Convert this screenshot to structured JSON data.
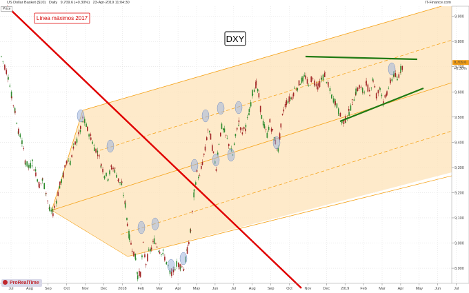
{
  "header": {
    "instrument": "US Dollar Basket ($10)",
    "interval": "Daily",
    "quote": "9,709.6 (+0.30%)",
    "timestamp": "23-Apr-2019 11:04:30",
    "source": "IT-Finance.com",
    "price_label": "Price"
  },
  "logo": {
    "text": "ProRealTime"
  },
  "chart_data": {
    "type": "candlestick",
    "title": "",
    "x_tick_labels": [
      "Jul",
      "Aug",
      "Sep",
      "Oct",
      "Nov",
      "Dec",
      "2018",
      "Feb",
      "Mar",
      "Apr",
      "May",
      "Jun",
      "Jul",
      "Aug",
      "Sep",
      "Oct",
      "Nov",
      "Dec",
      "2019",
      "Feb",
      "Mar",
      "Apr",
      "May",
      "Jun",
      "Jul"
    ],
    "y_tick_labels": [
      "9,900",
      "9,800",
      "9,700",
      "9,600",
      "9,500",
      "9,400",
      "9,300",
      "9,200",
      "9,100",
      "9,000",
      "8,900"
    ],
    "y_tick_values": [
      9900,
      9800,
      9700,
      9600,
      9500,
      9400,
      9300,
      9200,
      9100,
      9000,
      8900
    ],
    "ylim": [
      8840,
      9940
    ],
    "last_price_label": "9,709.6",
    "last_change_label": "+0.30%",
    "last_price": 9709.6,
    "price_path": [
      [
        0,
        9740
      ],
      [
        5,
        9700
      ],
      [
        10,
        9660
      ],
      [
        15,
        9580
      ],
      [
        20,
        9520
      ],
      [
        25,
        9440
      ],
      [
        30,
        9400
      ],
      [
        35,
        9320
      ],
      [
        40,
        9300
      ],
      [
        45,
        9320
      ],
      [
        50,
        9280
      ],
      [
        55,
        9230
      ],
      [
        60,
        9250
      ],
      [
        65,
        9200
      ],
      [
        70,
        9130
      ],
      [
        75,
        9120
      ],
      [
        80,
        9170
      ],
      [
        85,
        9230
      ],
      [
        90,
        9270
      ],
      [
        95,
        9330
      ],
      [
        100,
        9320
      ],
      [
        105,
        9380
      ],
      [
        110,
        9410
      ],
      [
        115,
        9450
      ],
      [
        118,
        9490
      ],
      [
        121,
        9480
      ],
      [
        125,
        9450
      ],
      [
        130,
        9420
      ],
      [
        135,
        9380
      ],
      [
        140,
        9360
      ],
      [
        145,
        9310
      ],
      [
        150,
        9270
      ],
      [
        155,
        9260
      ],
      [
        160,
        9300
      ],
      [
        165,
        9290
      ],
      [
        170,
        9250
      ],
      [
        175,
        9230
      ],
      [
        180,
        9150
      ],
      [
        183,
        9080
      ],
      [
        186,
        9020
      ],
      [
        190,
        8980
      ],
      [
        195,
        8940
      ],
      [
        198,
        8870
      ],
      [
        202,
        8880
      ],
      [
        206,
        8990
      ],
      [
        210,
        8920
      ],
      [
        214,
        8960
      ],
      [
        218,
        8980
      ],
      [
        222,
        9010
      ],
      [
        226,
        8990
      ],
      [
        230,
        8970
      ],
      [
        235,
        8960
      ],
      [
        240,
        8920
      ],
      [
        245,
        8880
      ],
      [
        250,
        8890
      ],
      [
        255,
        8920
      ],
      [
        260,
        8910
      ],
      [
        265,
        8900
      ],
      [
        270,
        8970
      ],
      [
        275,
        9050
      ],
      [
        280,
        9200
      ],
      [
        284,
        9280
      ],
      [
        288,
        9260
      ],
      [
        292,
        9320
      ],
      [
        296,
        9370
      ],
      [
        300,
        9450
      ],
      [
        304,
        9420
      ],
      [
        308,
        9350
      ],
      [
        312,
        9300
      ],
      [
        316,
        9400
      ],
      [
        320,
        9460
      ],
      [
        324,
        9440
      ],
      [
        328,
        9410
      ],
      [
        332,
        9380
      ],
      [
        336,
        9350
      ],
      [
        340,
        9420
      ],
      [
        345,
        9480
      ],
      [
        350,
        9440
      ],
      [
        355,
        9460
      ],
      [
        360,
        9520
      ],
      [
        365,
        9600
      ],
      [
        370,
        9630
      ],
      [
        374,
        9580
      ],
      [
        378,
        9500
      ],
      [
        382,
        9460
      ],
      [
        386,
        9430
      ],
      [
        390,
        9480
      ],
      [
        394,
        9440
      ],
      [
        398,
        9400
      ],
      [
        402,
        9370
      ],
      [
        406,
        9460
      ],
      [
        410,
        9530
      ],
      [
        414,
        9560
      ],
      [
        418,
        9570
      ],
      [
        422,
        9580
      ],
      [
        426,
        9610
      ],
      [
        430,
        9620
      ],
      [
        434,
        9640
      ],
      [
        438,
        9650
      ],
      [
        442,
        9660
      ],
      [
        446,
        9620
      ],
      [
        450,
        9650
      ],
      [
        455,
        9640
      ],
      [
        460,
        9620
      ],
      [
        465,
        9650
      ],
      [
        470,
        9670
      ],
      [
        475,
        9620
      ],
      [
        480,
        9580
      ],
      [
        485,
        9560
      ],
      [
        490,
        9520
      ],
      [
        495,
        9480
      ],
      [
        500,
        9490
      ],
      [
        505,
        9520
      ],
      [
        510,
        9560
      ],
      [
        515,
        9600
      ],
      [
        520,
        9620
      ],
      [
        525,
        9600
      ],
      [
        530,
        9630
      ],
      [
        535,
        9600
      ],
      [
        540,
        9650
      ],
      [
        545,
        9580
      ],
      [
        550,
        9620
      ],
      [
        555,
        9550
      ],
      [
        560,
        9600
      ],
      [
        565,
        9640
      ],
      [
        570,
        9670
      ],
      [
        575,
        9650
      ],
      [
        580,
        9690
      ],
      [
        584,
        9709.6
      ]
    ],
    "annotations": {
      "high_line_label": "Línea máximos 2017",
      "symbol_box": "DXY"
    }
  },
  "colors": {
    "channel_fill": "#fde3b8",
    "channel_line": "#f5a31a",
    "trend_red": "#e00000",
    "triangle_green": "#1f7a12",
    "candle_up": "#2e8b2e",
    "candle_down": "#a12525",
    "marker": "#9fb4dd",
    "price_tag": "#f39c12"
  }
}
